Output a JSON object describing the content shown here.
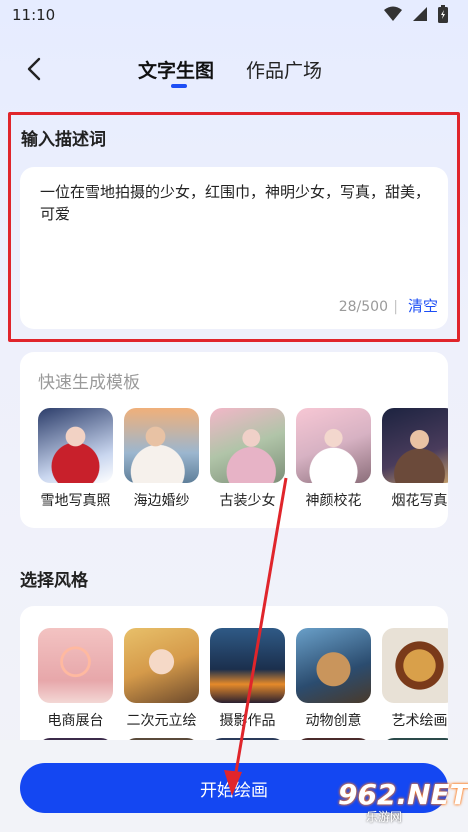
{
  "status_bar": {
    "time": "11:10"
  },
  "nav": {
    "tab_active": "文字生图",
    "tab_inactive": "作品广场"
  },
  "input_section": {
    "title": "输入描述词",
    "text": "一位在雪地拍摄的少女，红围巾，神明少女，写真，甜美，可爱",
    "counter": "28/500",
    "divider": "|",
    "clear_label": "清空"
  },
  "templates": {
    "title": "快速生成模板",
    "items": [
      {
        "label": "雪地写真照"
      },
      {
        "label": "海边婚纱"
      },
      {
        "label": "古装少女"
      },
      {
        "label": "神颜校花"
      },
      {
        "label": "烟花写真"
      }
    ]
  },
  "styles": {
    "title": "选择风格",
    "items": [
      {
        "label": "电商展台"
      },
      {
        "label": "二次元立绘"
      },
      {
        "label": "摄影作品"
      },
      {
        "label": "动物创意"
      },
      {
        "label": "艺术绘画"
      }
    ]
  },
  "start_button": {
    "label": "开始绘画"
  },
  "watermark": {
    "main": "962.NET",
    "sub": "乐游网"
  },
  "colors": {
    "accent": "#1447f2",
    "highlight_red": "#e0252b"
  },
  "icons": [
    "back-arrow-icon",
    "wifi-icon",
    "signal-icon",
    "battery-icon"
  ]
}
